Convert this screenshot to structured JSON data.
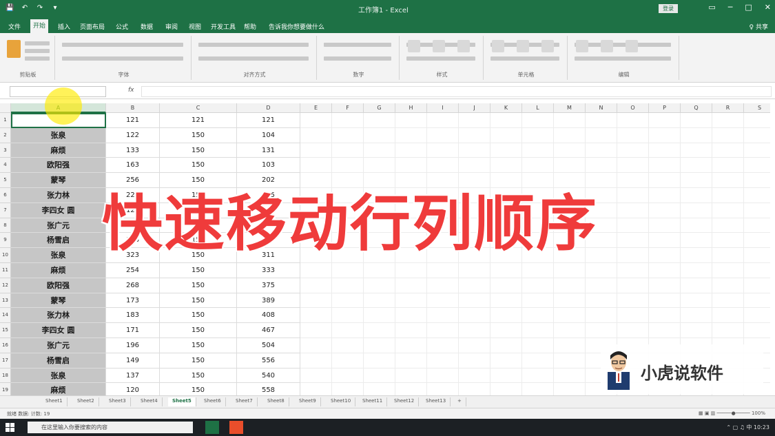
{
  "window": {
    "qat": [
      "💾",
      "↶",
      "↷",
      "▾"
    ],
    "doc_title": "工作簿1 - Excel",
    "signin": "登录",
    "controls": [
      "▭",
      "─",
      "□",
      "✕"
    ]
  },
  "ribbon_tabs": [
    "文件",
    "开始",
    "插入",
    "页面布局",
    "公式",
    "数据",
    "审阅",
    "视图",
    "开发工具",
    "帮助",
    "告诉我你想要做什么"
  ],
  "active_tab_index": 1,
  "share_label": "♀ 共享",
  "ribbon_groups": [
    "剪贴板",
    "字体",
    "对齐方式",
    "数字",
    "样式",
    "单元格",
    "编辑"
  ],
  "formula_bar": {
    "namebox": "",
    "fx": "fx",
    "content": ""
  },
  "columns": [
    "A",
    "B",
    "C",
    "D",
    "E",
    "F",
    "G",
    "H",
    "I",
    "J",
    "K",
    "L",
    "M",
    "N",
    "O",
    "P",
    "Q",
    "R",
    "S"
  ],
  "selected_column": "A",
  "rows": [
    [
      "",
      "121",
      "121",
      "121"
    ],
    [
      "张泉",
      "122",
      "150",
      "104"
    ],
    [
      "麻烦",
      "133",
      "150",
      "131"
    ],
    [
      "欧阳强",
      "163",
      "150",
      "103"
    ],
    [
      "蒙琴",
      "256",
      "150",
      "202"
    ],
    [
      "张力林",
      "222",
      "150",
      "245"
    ],
    [
      "李四女 圆",
      "121",
      "150",
      "150"
    ],
    [
      "张广元",
      "232",
      "150",
      "267"
    ],
    [
      "杨雪启",
      "156",
      "150",
      "289"
    ],
    [
      "张泉",
      "323",
      "150",
      "311"
    ],
    [
      "麻烦",
      "254",
      "150",
      "333"
    ],
    [
      "欧阳强",
      "268",
      "150",
      "375"
    ],
    [
      "蒙琴",
      "173",
      "150",
      "389"
    ],
    [
      "张力林",
      "183",
      "150",
      "408"
    ],
    [
      "李四女 圆",
      "171",
      "150",
      "467"
    ],
    [
      "张广元",
      "196",
      "150",
      "504"
    ],
    [
      "杨雪启",
      "149",
      "150",
      "556"
    ],
    [
      "张泉",
      "137",
      "150",
      "540"
    ],
    [
      "麻烦",
      "120",
      "150",
      "558"
    ]
  ],
  "overlay_title": "快速移动行列顺序",
  "watermark_text": "小虎说软件",
  "sheet_tabs": [
    "Sheet1",
    "Sheet2",
    "Sheet3",
    "Sheet4",
    "Sheet5",
    "Sheet6",
    "Sheet7",
    "Sheet8",
    "Sheet9",
    "Sheet10",
    "Sheet11",
    "Sheet12",
    "Sheet13",
    "+"
  ],
  "active_sheet_index": 4,
  "status": {
    "left": "就绪   数据: 计数: 19",
    "right": "▦ ▣ ▥   ─────●───── 100%"
  },
  "taskbar": {
    "search_placeholder": "在这里输入你要搜索的内容",
    "tray": "⌃ ▢ ♫ 中  10:23"
  },
  "colors": {
    "excel_green": "#1e7145",
    "overlay_red": "#ef3b3b",
    "name_cell_gray": "#c6c6c6",
    "highlight_yellow": "#ffeb00"
  }
}
